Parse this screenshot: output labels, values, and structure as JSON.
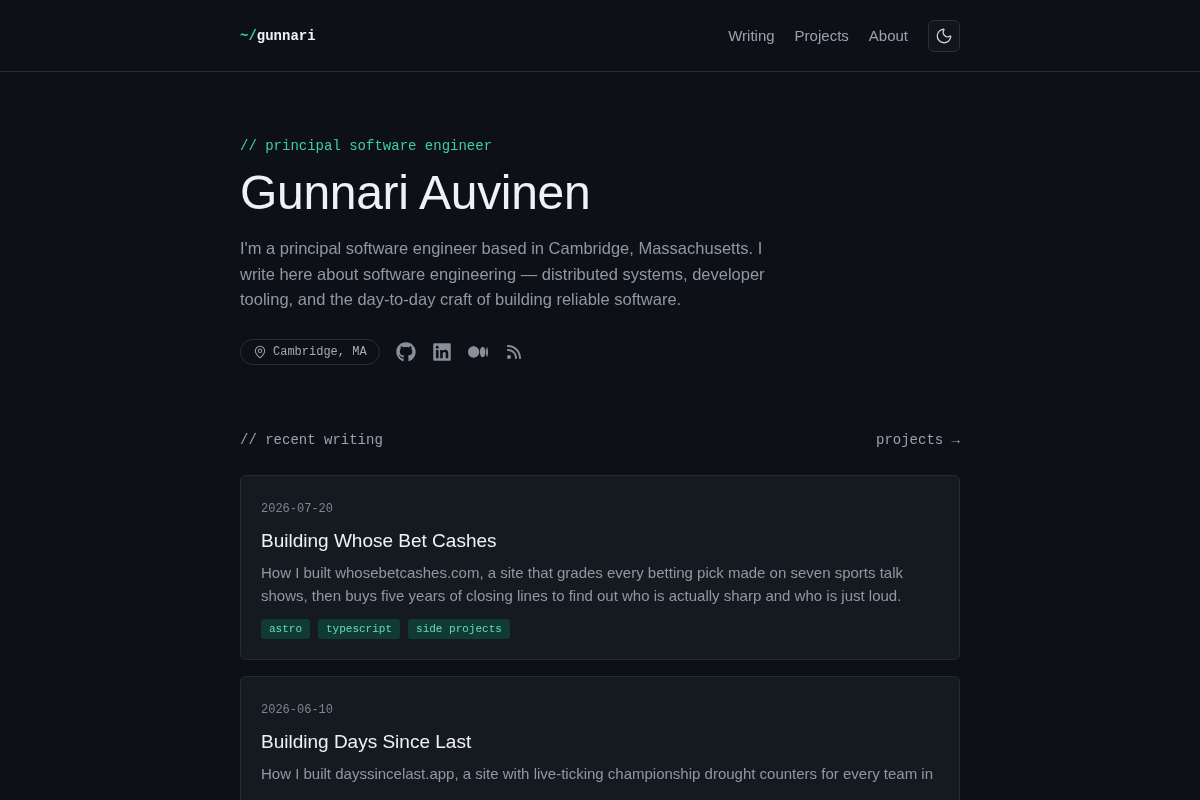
{
  "header": {
    "logo": {
      "prefix": "~/",
      "name": "gunnari"
    },
    "nav": [
      {
        "label": "Writing"
      },
      {
        "label": "Projects"
      },
      {
        "label": "About"
      }
    ],
    "dark_mode": true
  },
  "hero": {
    "eyebrow": "// principal software engineer",
    "name": "Gunnari Auvinen",
    "bio": "I'm a principal software engineer based in Cambridge, Massachusetts. I write here about software engineering — distributed systems, developer tooling, and the day-to-day craft of building reliable software.",
    "location": "Cambridge, MA",
    "social": [
      {
        "kind": "github"
      },
      {
        "kind": "linkedin"
      },
      {
        "kind": "medium"
      },
      {
        "kind": "rss"
      }
    ]
  },
  "recent": {
    "heading": "// recent writing",
    "link": "projects →"
  },
  "posts": [
    {
      "date": "2026-07-20",
      "title": "Building Whose Bet Cashes",
      "summary": "How I built whosebetcashes.com, a site that grades every betting pick made on seven sports talk shows, then buys five years of closing lines to find out who is actually sharp and who is just loud.",
      "tags": [
        "astro",
        "typescript",
        "side projects"
      ]
    },
    {
      "date": "2026-06-10",
      "title": "Building Days Since Last",
      "summary": "How I built dayssincelast.app, a site with live-ticking championship drought counters for every team in"
    }
  ]
}
